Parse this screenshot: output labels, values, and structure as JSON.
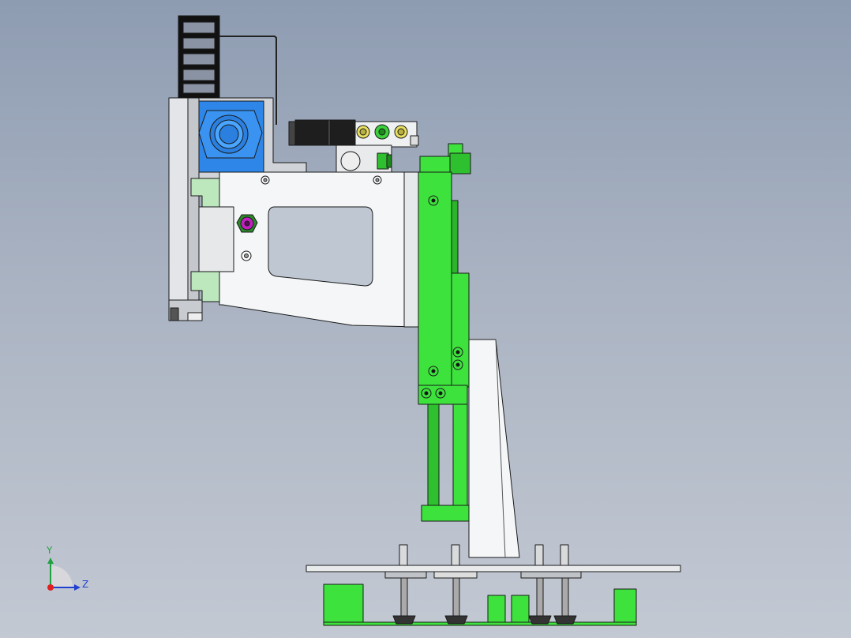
{
  "triad": {
    "y_label": "Y",
    "z_label": "Z",
    "x_color": "#e02020",
    "y_color": "#20a040",
    "z_color": "#2040d0"
  },
  "colors": {
    "part_green": "#3de23d",
    "part_blue": "#2e86e8",
    "part_white": "#f4f6f8",
    "part_gray": "#c9ccd0",
    "edge": "#1a1a1a",
    "fitting_magenta": "#c020c0"
  }
}
